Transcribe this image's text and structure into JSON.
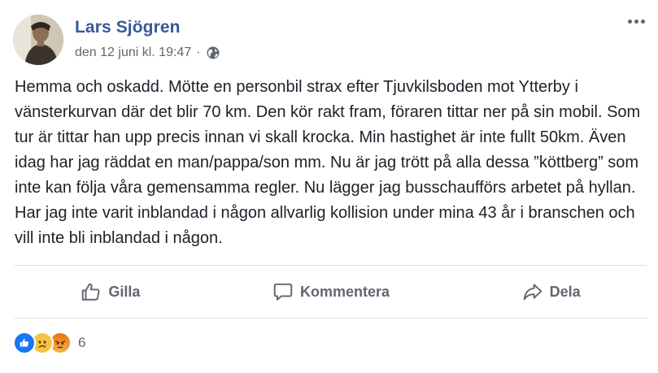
{
  "post": {
    "author": "Lars Sjögren",
    "timestamp": "den 12 juni kl. 19:47",
    "separator": "·",
    "privacy_icon": "globe-icon",
    "body": "Hemma och oskadd. Mötte en personbil strax efter Tjuvkilsboden mot Ytterby i vänsterkurvan där det blir 70 km. Den kör rakt fram, föraren tittar ner på sin mobil. Som tur är tittar han upp precis innan vi skall krocka. Min hastighet är inte fullt 50km. Även idag har jag räddat en man/pappa/son mm. Nu är jag trött på alla dessa ”köttberg” som inte kan följa våra gemensamma regler. Nu lägger jag busschaufförs arbetet på hyllan. Har jag inte varit inblandad i någon allvarlig kollision under mina 43 år i branschen och vill inte bli inblandad i någon."
  },
  "actions": {
    "like_label": "Gilla",
    "comment_label": "Kommentera",
    "share_label": "Dela"
  },
  "reactions": {
    "types": [
      "like",
      "sad",
      "angry"
    ],
    "count": "6"
  },
  "colors": {
    "author": "#385898",
    "text": "#1d2129",
    "muted": "#606770",
    "like_blue": "#1877f2",
    "divider": "#dddfe2"
  }
}
